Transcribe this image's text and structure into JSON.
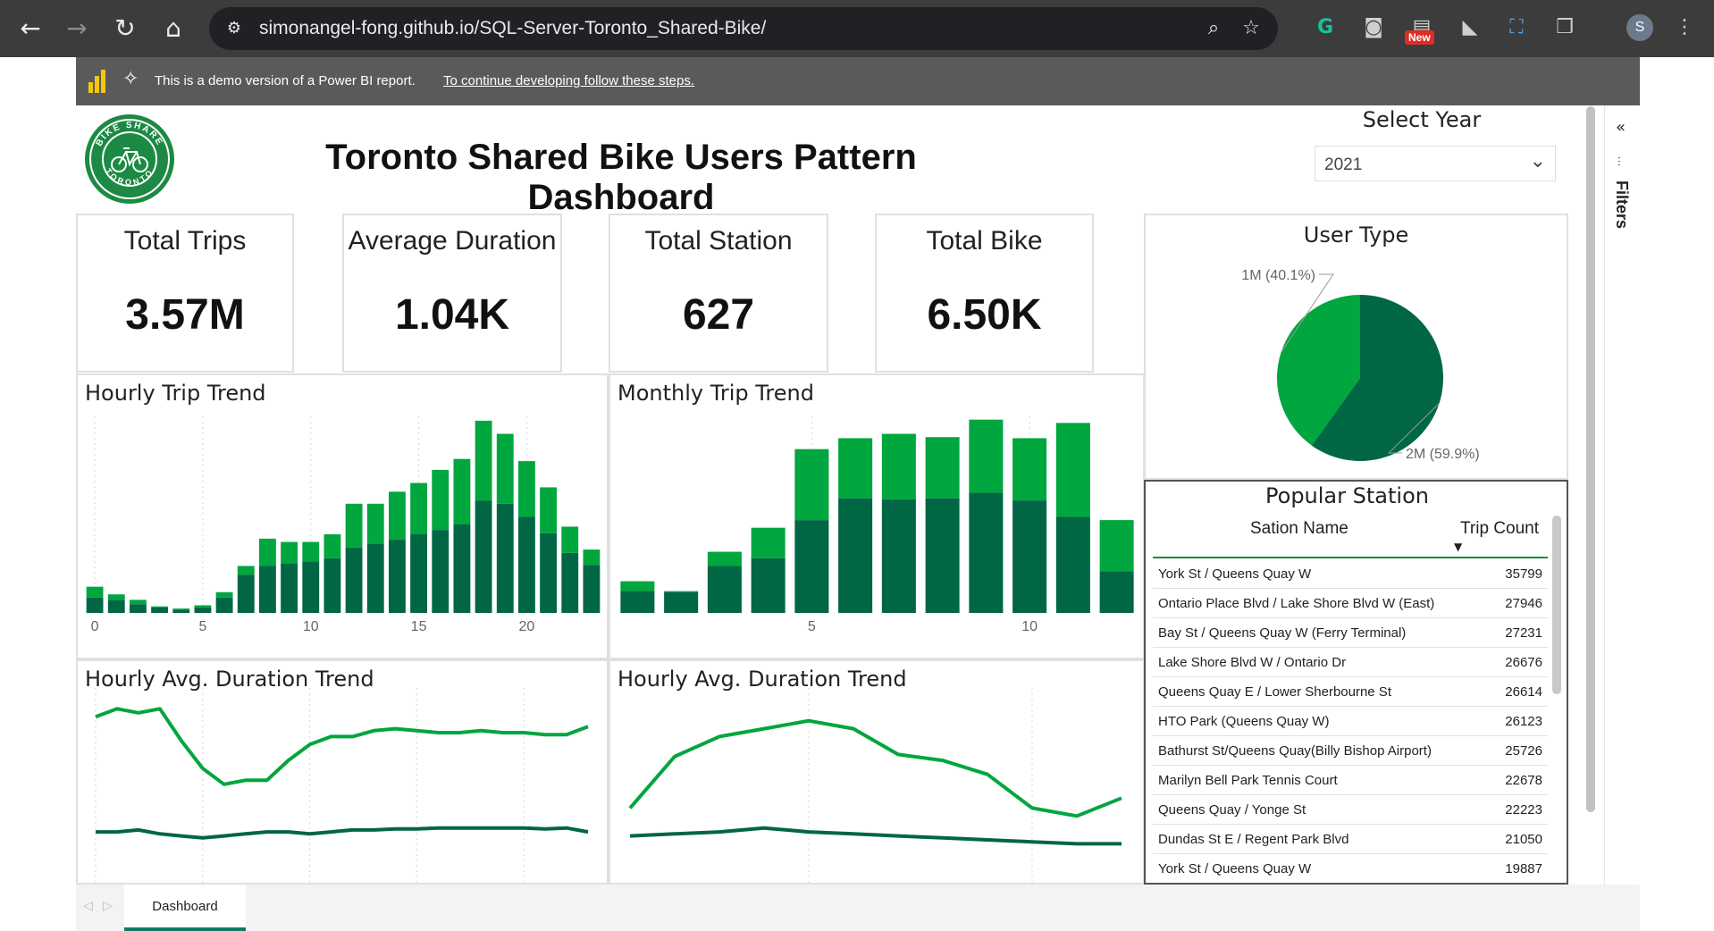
{
  "browser": {
    "url": "simonangel-fong.github.io/SQL-Server-Toronto_Shared-Bike/",
    "new_badge": "New",
    "profile_initial": "S",
    "icons": [
      "back-arrow-icon",
      "forward-arrow-icon",
      "reload-icon",
      "home-icon",
      "site-info-icon",
      "zoom-icon",
      "bookmark-star-icon",
      "grammarly-icon",
      "camera-icon",
      "extension-icon",
      "puzzle-icon",
      "menu-icon"
    ]
  },
  "banner": {
    "text": "This is a demo version of a Power BI report.",
    "link": "To continue developing follow these steps."
  },
  "report": {
    "logo_text_top": "BIKE SHARE",
    "logo_text_bottom": "TORONTO",
    "title": "Toronto Shared Bike Users Pattern Dashboard",
    "select_year_label": "Select Year",
    "selected_year": "2021"
  },
  "kpis": [
    {
      "label": "Total Trips",
      "value": "3.57M"
    },
    {
      "label": "Average Duration",
      "value": "1.04K"
    },
    {
      "label": "Total Station",
      "value": "627"
    },
    {
      "label": "Total Bike",
      "value": "6.50K"
    }
  ],
  "colors": {
    "dark_green": "#006644",
    "light_green": "#00a63e",
    "accent": "#117865"
  },
  "chart_data": [
    {
      "type": "bar",
      "title": "Hourly Trip Trend",
      "stacked": true,
      "x_ticks": [
        "0",
        "5",
        "10",
        "15",
        "20"
      ],
      "categories": [
        0,
        1,
        2,
        3,
        4,
        5,
        6,
        7,
        8,
        9,
        10,
        11,
        12,
        13,
        14,
        15,
        16,
        17,
        18,
        19,
        20,
        21,
        22,
        23
      ],
      "series": [
        {
          "values": [
            14,
            12,
            8,
            5,
            3,
            5,
            14,
            35,
            43,
            45,
            47,
            50,
            60,
            63,
            67,
            72,
            76,
            81,
            103,
            100,
            88,
            73,
            55,
            44
          ]
        },
        {
          "values": [
            10,
            5,
            4,
            1,
            1,
            2,
            5,
            8,
            25,
            20,
            18,
            22,
            40,
            37,
            44,
            47,
            55,
            60,
            73,
            64,
            51,
            42,
            24,
            14
          ]
        }
      ],
      "ylim": [
        0,
        180
      ],
      "grid": true,
      "legend": "none"
    },
    {
      "type": "bar",
      "title": "Monthly Trip Trend",
      "stacked": true,
      "x_ticks": [
        "5",
        "10"
      ],
      "categories": [
        1,
        2,
        3,
        4,
        5,
        6,
        7,
        8,
        9,
        10,
        11,
        12
      ],
      "series": [
        {
          "values": [
            20,
            19,
            43,
            50,
            85,
            105,
            104,
            105,
            110,
            103,
            88,
            38
          ]
        },
        {
          "values": [
            9,
            1,
            13,
            28,
            65,
            55,
            60,
            56,
            67,
            57,
            86,
            47
          ]
        }
      ],
      "ylim": [
        0,
        180
      ],
      "grid": true,
      "legend": "none"
    },
    {
      "type": "line",
      "title": "Hourly Avg. Duration Trend",
      "x": [
        0,
        1,
        2,
        3,
        4,
        5,
        6,
        7,
        8,
        9,
        10,
        11,
        12,
        13,
        14,
        15,
        16,
        17,
        18,
        19,
        20,
        21,
        22,
        23
      ],
      "series": [
        {
          "values": [
            1100,
            1140,
            1120,
            1140,
            980,
            840,
            760,
            780,
            780,
            880,
            960,
            1000,
            1000,
            1030,
            1040,
            1030,
            1020,
            1020,
            1030,
            1020,
            1020,
            1010,
            1010,
            1050
          ]
        },
        {
          "values": [
            520,
            520,
            530,
            510,
            500,
            490,
            500,
            510,
            520,
            520,
            510,
            520,
            530,
            530,
            535,
            535,
            540,
            540,
            540,
            540,
            540,
            535,
            540,
            520
          ]
        }
      ],
      "ylim": [
        300,
        1200
      ],
      "grid": true,
      "legend": "none"
    },
    {
      "type": "line",
      "title": "Hourly Avg. Duration Trend",
      "x": [
        1,
        2,
        3,
        4,
        5,
        6,
        7,
        8,
        9,
        10,
        11,
        12
      ],
      "series": [
        {
          "values": [
            640,
            900,
            1000,
            1040,
            1080,
            1040,
            910,
            880,
            810,
            640,
            600,
            690
          ]
        },
        {
          "values": [
            500,
            510,
            520,
            540,
            520,
            510,
            500,
            490,
            480,
            470,
            460,
            460
          ]
        }
      ],
      "ylim": [
        300,
        1200
      ],
      "grid": true,
      "legend": "none"
    },
    {
      "type": "pie",
      "title": "User Type",
      "slices": [
        {
          "label": "2M (59.9%)",
          "value": 59.9,
          "color": "#006644"
        },
        {
          "label": "1M (40.1%)",
          "value": 40.1,
          "color": "#00a63e"
        }
      ]
    }
  ],
  "popular_station": {
    "title": "Popular Station",
    "col_name": "Sation Name",
    "col_count": "Trip Count",
    "rows": [
      {
        "name": "York St / Queens Quay W",
        "count": "35799"
      },
      {
        "name": "Ontario Place Blvd / Lake Shore Blvd W (East)",
        "count": "27946"
      },
      {
        "name": "Bay St / Queens Quay W (Ferry Terminal)",
        "count": "27231"
      },
      {
        "name": "Lake Shore Blvd W / Ontario Dr",
        "count": "26676"
      },
      {
        "name": "Queens Quay E / Lower Sherbourne St",
        "count": "26614"
      },
      {
        "name": "HTO Park (Queens Quay W)",
        "count": "26123"
      },
      {
        "name": "Bathurst St/Queens Quay(Billy Bishop Airport)",
        "count": "25726"
      },
      {
        "name": "Marilyn Bell Park Tennis Court",
        "count": "22678"
      },
      {
        "name": "Queens Quay / Yonge St",
        "count": "22223"
      },
      {
        "name": "Dundas St E / Regent Park Blvd",
        "count": "21050"
      },
      {
        "name": "York St / Queens Quay W",
        "count": "19887"
      }
    ]
  },
  "filters": {
    "label": "Filters"
  },
  "tabs": {
    "active": "Dashboard"
  }
}
